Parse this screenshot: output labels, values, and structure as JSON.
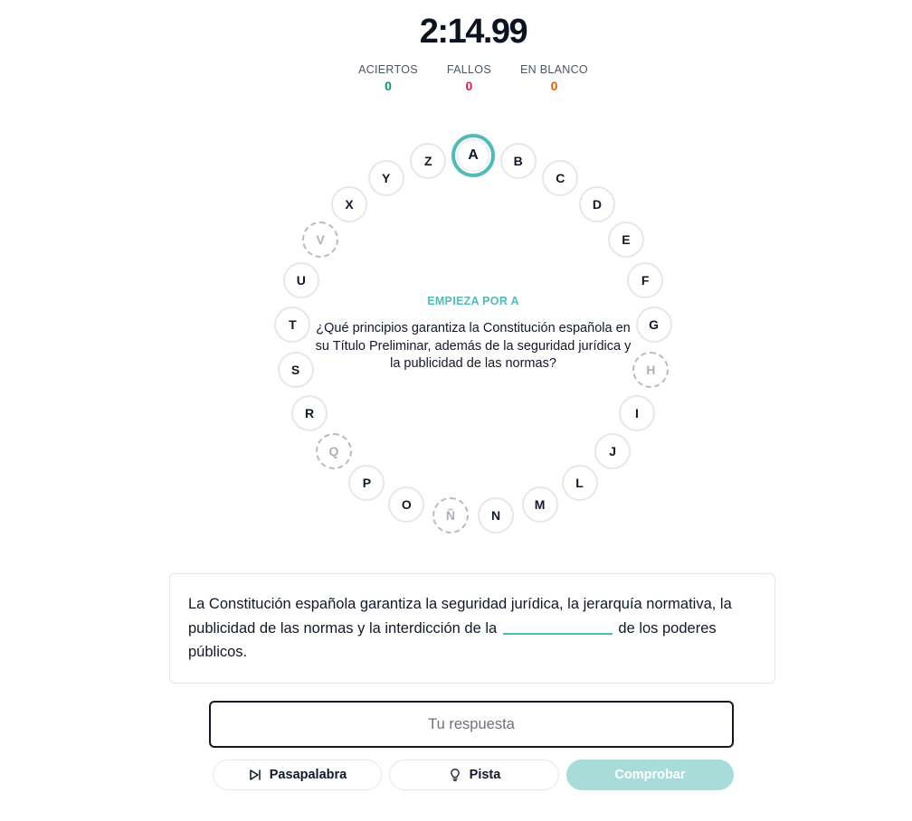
{
  "timer": "2:14.99",
  "stats": [
    {
      "label": "ACIERTOS",
      "value": "0",
      "color": "#059669"
    },
    {
      "label": "FALLOS",
      "value": "0",
      "color": "#e11d48"
    },
    {
      "label": "EN BLANCO",
      "value": "0",
      "color": "#ea580c"
    }
  ],
  "wheel": {
    "letters": [
      "A",
      "B",
      "C",
      "D",
      "E",
      "F",
      "G",
      "H",
      "I",
      "J",
      "L",
      "M",
      "N",
      "Ñ",
      "O",
      "P",
      "Q",
      "R",
      "S",
      "T",
      "U",
      "V",
      "X",
      "Y",
      "Z"
    ],
    "active": "A",
    "dashed": [
      "H",
      "Ñ",
      "Q",
      "V"
    ],
    "accent_color": "#4fbcb8"
  },
  "question": {
    "label": "EMPIEZA POR A",
    "text": "¿Qué principios garantiza la Constitución española en su Título Preliminar, además de la seguridad jurídica y la publicidad de las normas?"
  },
  "hint_card": {
    "before": "La Constitución española garantiza la seguridad jurídica, la jerarquía normativa, la publicidad de las normas y la interdicción de la",
    "after": "de los poderes públicos."
  },
  "answer": {
    "placeholder": "Tu respuesta"
  },
  "buttons": {
    "pasapalabra": "Pasapalabra",
    "pista": "Pista",
    "comprobar": "Comprobar"
  },
  "icons": {
    "pasapalabra": "skip-forward-icon",
    "pista": "lightbulb-icon"
  }
}
